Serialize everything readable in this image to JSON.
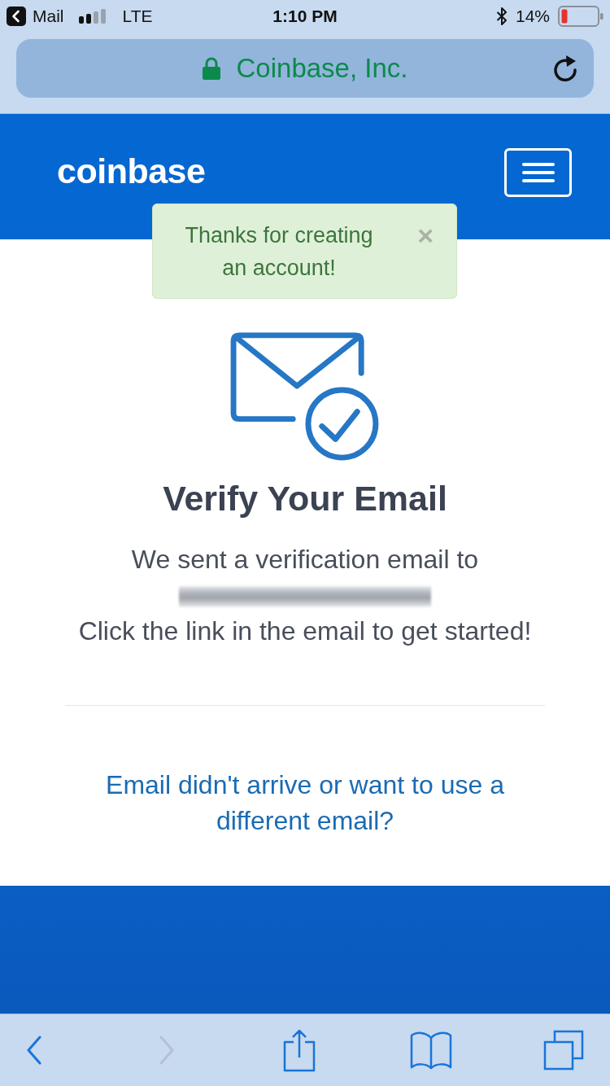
{
  "status_bar": {
    "back_app": "Mail",
    "network": "LTE",
    "time": "1:10 PM",
    "battery": "14%"
  },
  "address_bar": {
    "title": "Coinbase, Inc.",
    "secure": true
  },
  "header": {
    "logo": "coinbase"
  },
  "alert": {
    "message": "Thanks for creating an account!",
    "close": "×"
  },
  "verify": {
    "title": "Verify Your Email",
    "sent_text": "We sent a verification email to",
    "instruction": "Click the link in the email to get started!",
    "help_link": "Email didn't arrive or want to use a different email?"
  },
  "toolbar": [
    {
      "kind": "back",
      "disabled": false
    },
    {
      "kind": "forward",
      "disabled": true
    },
    {
      "kind": "share",
      "disabled": false
    },
    {
      "kind": "bookmarks",
      "disabled": false
    },
    {
      "kind": "tabs",
      "disabled": false
    }
  ]
}
